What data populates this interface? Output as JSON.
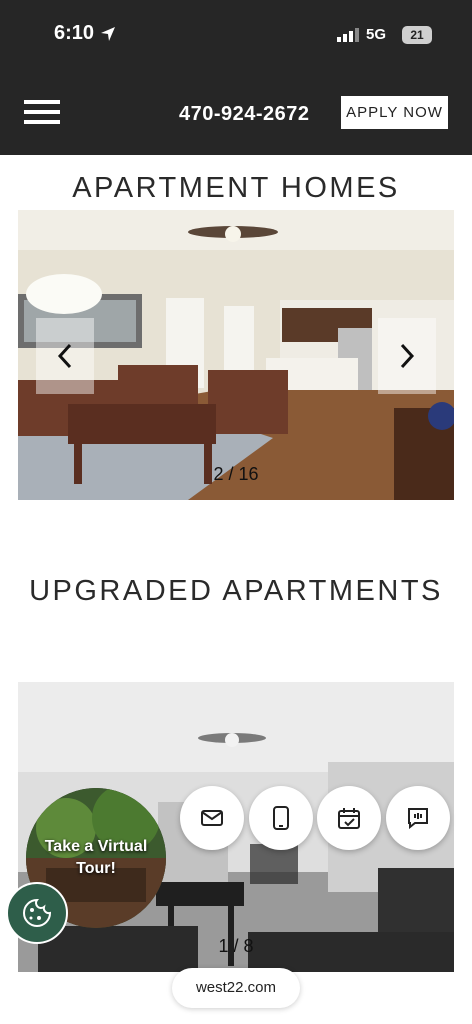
{
  "status": {
    "time": "6:10",
    "network": "5G",
    "battery": "21"
  },
  "header": {
    "phone": "470-924-2672",
    "apply_label": "APPLY NOW"
  },
  "sections": [
    {
      "title": "APARTMENT HOMES",
      "counter": "2 / 16"
    },
    {
      "title": "UPGRADED APARTMENTS",
      "counter": "1 / 8"
    }
  ],
  "virtual_tour": {
    "label": "Take a Virtual Tour!"
  },
  "quick_actions": [
    {
      "icon": "envelope-icon"
    },
    {
      "icon": "phone-icon"
    },
    {
      "icon": "calendar-check-icon"
    },
    {
      "icon": "chat-icon"
    }
  ],
  "browser": {
    "url": "west22.com"
  },
  "colors": {
    "header_bg": "#262626",
    "cookie_bg": "#2e5e4a"
  }
}
